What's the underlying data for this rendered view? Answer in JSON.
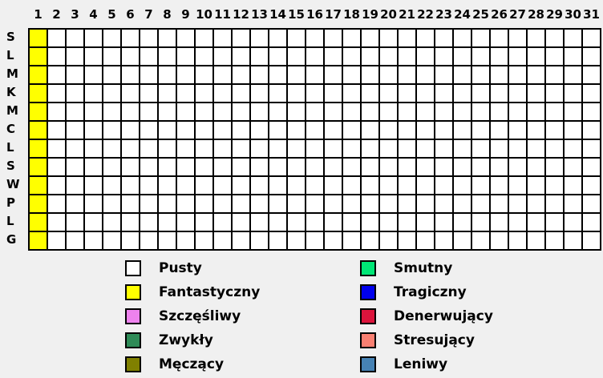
{
  "columns": [
    "1",
    "2",
    "3",
    "4",
    "5",
    "6",
    "7",
    "8",
    "9",
    "10",
    "11",
    "12",
    "13",
    "14",
    "15",
    "16",
    "17",
    "18",
    "19",
    "20",
    "21",
    "22",
    "23",
    "24",
    "25",
    "26",
    "27",
    "28",
    "29",
    "30",
    "31"
  ],
  "rows": [
    "S",
    "L",
    "M",
    "K",
    "M",
    "C",
    "L",
    "S",
    "W",
    "P",
    "L",
    "G"
  ],
  "colors": {
    "empty": "#ffffff",
    "fantastic": "#ffff00"
  },
  "filled": [
    {
      "row": 0,
      "col": 0,
      "mood": "Fantastyczny"
    },
    {
      "row": 1,
      "col": 0,
      "mood": "Fantastyczny"
    },
    {
      "row": 2,
      "col": 0,
      "mood": "Fantastyczny"
    },
    {
      "row": 3,
      "col": 0,
      "mood": "Fantastyczny"
    },
    {
      "row": 4,
      "col": 0,
      "mood": "Fantastyczny"
    },
    {
      "row": 5,
      "col": 0,
      "mood": "Fantastyczny"
    },
    {
      "row": 6,
      "col": 0,
      "mood": "Fantastyczny"
    },
    {
      "row": 7,
      "col": 0,
      "mood": "Fantastyczny"
    },
    {
      "row": 8,
      "col": 0,
      "mood": "Fantastyczny"
    },
    {
      "row": 9,
      "col": 0,
      "mood": "Fantastyczny"
    },
    {
      "row": 10,
      "col": 0,
      "mood": "Fantastyczny"
    },
    {
      "row": 11,
      "col": 0,
      "mood": "Fantastyczny"
    }
  ],
  "legend": [
    {
      "label": "Pusty",
      "color": "#ffffff"
    },
    {
      "label": "Fantastyczny",
      "color": "#ffff00"
    },
    {
      "label": "Szczęśliwy",
      "color": "#ee82ee"
    },
    {
      "label": "Zwykły",
      "color": "#2e8b57"
    },
    {
      "label": "Męczący",
      "color": "#808000"
    },
    {
      "label": "Smutny",
      "color": "#00e676"
    },
    {
      "label": "Tragiczny",
      "color": "#0000ee"
    },
    {
      "label": "Denerwujący",
      "color": "#dc143c"
    },
    {
      "label": "Stresujący",
      "color": "#fa8072"
    },
    {
      "label": "Leniwy",
      "color": "#4682b4"
    }
  ]
}
